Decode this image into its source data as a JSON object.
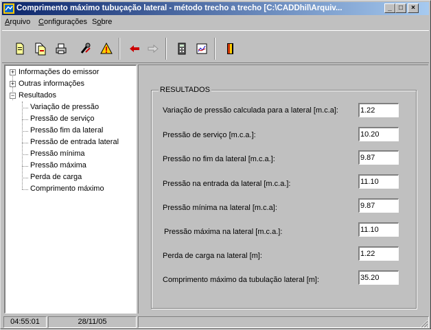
{
  "window": {
    "title": "Comprimento máximo tubuçação lateral - método trecho a trecho [C:\\CADDhil\\Arquiv...",
    "minimize_glyph": "_",
    "maximize_glyph": "□",
    "close_glyph": "×"
  },
  "menu": {
    "items": [
      {
        "accel": "A",
        "rest": "rquivo"
      },
      {
        "accel": "C",
        "rest": "onfigurações"
      },
      {
        "pre": "S",
        "accel": "o",
        "rest": "bre"
      }
    ]
  },
  "toolbar": {
    "icons": [
      "new-file-icon",
      "open-file-icon",
      "print-icon",
      "settings-tool-icon",
      "alert-icon",
      "back-arrow-icon",
      "forward-arrow-icon",
      "calculator-icon",
      "chart-icon",
      "exit-door-icon"
    ]
  },
  "tree": {
    "nodes": [
      {
        "label": "Informações do emissor",
        "expander": "+"
      },
      {
        "label": "Outras informações",
        "expander": "+"
      },
      {
        "label": "Resultados",
        "expander": "−"
      },
      {
        "label": "Variação de pressão"
      },
      {
        "label": "Pressão de serviço"
      },
      {
        "label": "Pressão fim da lateral"
      },
      {
        "label": "Pressão de entrada lateral"
      },
      {
        "label": "Pressão mínima"
      },
      {
        "label": "Pressão máxima"
      },
      {
        "label": "Perda de carga"
      },
      {
        "label": "Comprimento máximo"
      }
    ]
  },
  "results": {
    "group_title": "RESULTADOS",
    "fields": [
      {
        "label": "Variação de pressão calculada para a lateral [m.c.a]:",
        "value": "1.22"
      },
      {
        "label": "Pressão de serviço [m.c.a.]:",
        "value": "10.20"
      },
      {
        "label": "Pressão no fim da lateral [m.c.a.]:",
        "value": "9.87"
      },
      {
        "label": "Pressão na entrada da lateral [m.c.a.]:",
        "value": "11.10"
      },
      {
        "label": "Pressão mínima na lateral [m.c.a]:",
        "value": "9.87"
      },
      {
        "label": "Pressão máxima na lateral [m.c.a.]:",
        "value": "11.10"
      },
      {
        "label": "Perda de carga na lateral [m]:",
        "value": "1.22"
      },
      {
        "label": "Comprimento máximo da tubulação lateral [m]:",
        "value": "35.20"
      }
    ]
  },
  "status": {
    "time": "04:55:01",
    "date": "28/11/05"
  },
  "colors": {
    "titlebar_start": "#0a246a",
    "titlebar_end": "#a6caf0",
    "face": "#c0c0c0"
  }
}
